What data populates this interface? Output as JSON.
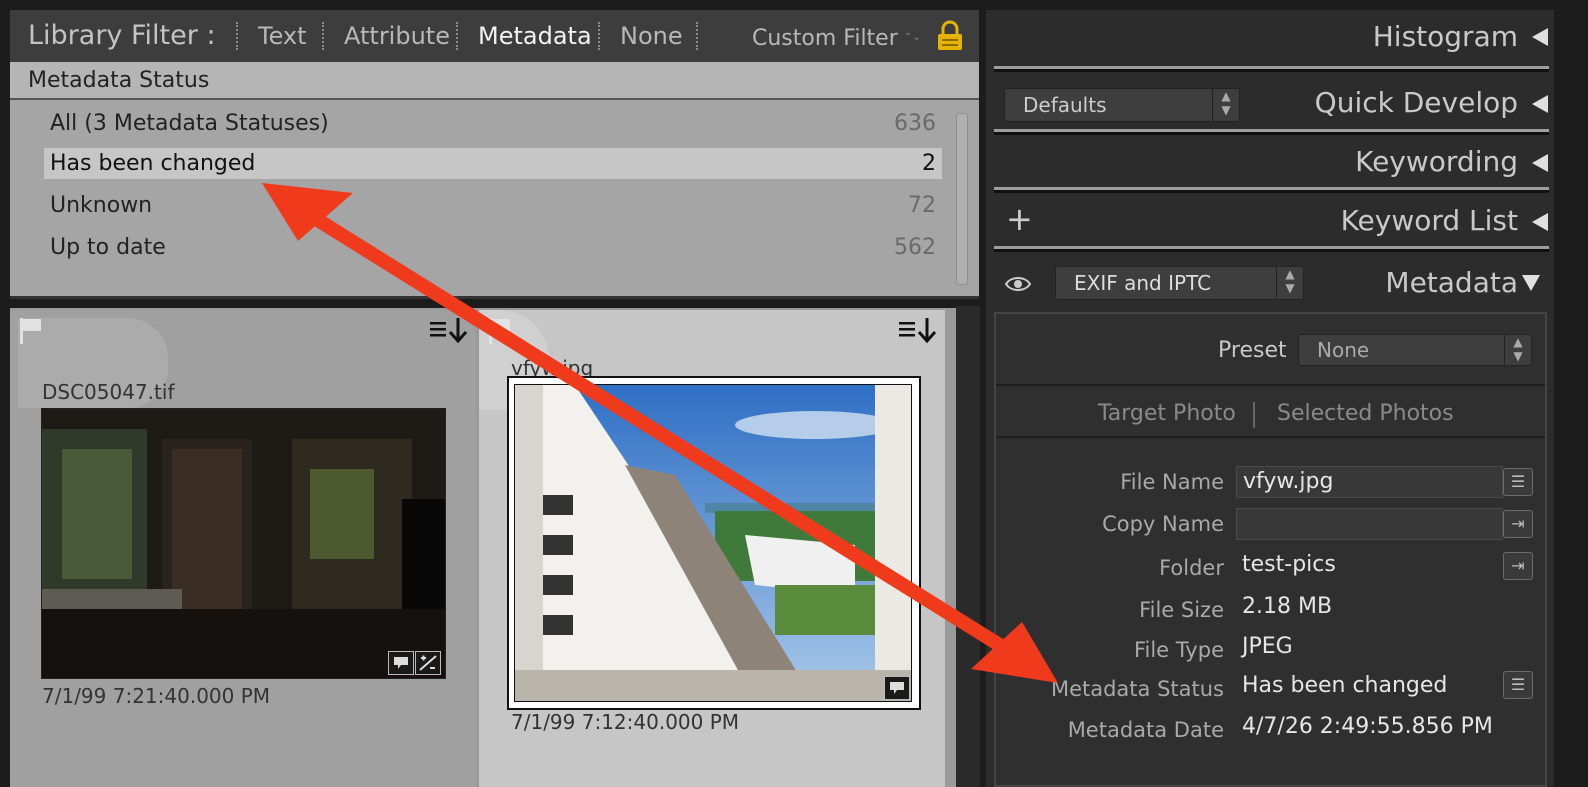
{
  "filter_bar": {
    "title": "Library Filter :",
    "tabs": [
      "Text",
      "Attribute",
      "Metadata",
      "None"
    ],
    "active_tab": "Metadata",
    "custom_filter": "Custom Filter",
    "custom_filter_arrows": "⌃⌄"
  },
  "metadata_status": {
    "header": "Metadata Status",
    "rows": [
      {
        "label": "All (3 Metadata Statuses)",
        "count": "636"
      },
      {
        "label": "Has been changed",
        "count": "2"
      },
      {
        "label": "Unknown",
        "count": "72"
      },
      {
        "label": "Up to date",
        "count": "562"
      }
    ]
  },
  "grid": {
    "cells": [
      {
        "filename": "DSC05047.tif",
        "date": "7/1/99 7:21:40.000 PM"
      },
      {
        "filename": "vfyw.jpg",
        "date": "7/1/99 7:12:40.000 PM"
      }
    ]
  },
  "panels": {
    "histogram": "Histogram",
    "quick_develop": "Quick Develop",
    "quick_develop_preset": "Defaults",
    "keywording": "Keywording",
    "keyword_list": "Keyword List",
    "plus": "+",
    "metadata": "Metadata",
    "metadata_view": "EXIF and IPTC"
  },
  "metadata_panel": {
    "preset_label": "Preset",
    "preset_value": "None",
    "target_photo": "Target Photo",
    "selected_photos": "Selected Photos",
    "fields": [
      {
        "label": "File Name",
        "value": "vfyw.jpg"
      },
      {
        "label": "Copy Name",
        "value": ""
      },
      {
        "label": "Folder",
        "value": "test-pics"
      },
      {
        "label": "File Size",
        "value": "2.18 MB"
      },
      {
        "label": "File Type",
        "value": "JPEG"
      },
      {
        "label": "Metadata Status",
        "value": "Has been changed"
      },
      {
        "label": "Metadata Date",
        "value": "4/7/26 2:49:55.856 PM"
      }
    ]
  },
  "colors": {
    "annotation_arrow": "#f03a1c"
  },
  "icons": [
    "lock-icon",
    "flag-icon",
    "sort-menu-icon",
    "comment-badge-icon",
    "develop-badge-icon",
    "eye-icon",
    "list-icon",
    "arrow-right-icon"
  ]
}
